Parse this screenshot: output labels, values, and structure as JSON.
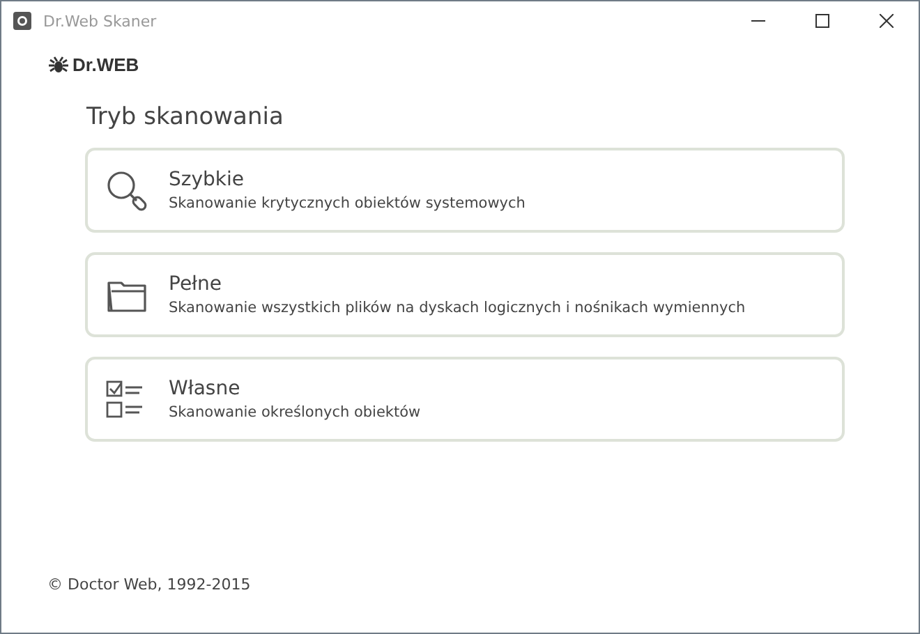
{
  "window": {
    "title": "Dr.Web Skaner"
  },
  "logo": {
    "text": "Dr.WEB"
  },
  "heading": "Tryb skanowania",
  "modes": [
    {
      "kind": "search",
      "title": "Szybkie",
      "description": "Skanowanie krytycznych obiektów systemowych"
    },
    {
      "kind": "folder",
      "title": "Pełne",
      "description": "Skanowanie wszystkich plików na dyskach logicznych i nośnikach wymiennych"
    },
    {
      "kind": "checklist",
      "title": "Własne",
      "description": "Skanowanie określonych obiektów"
    }
  ],
  "footer": "© Doctor Web, 1992-2015"
}
